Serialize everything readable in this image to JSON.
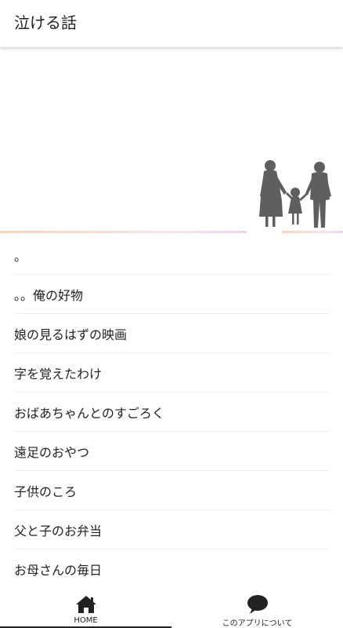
{
  "app_bar": {
    "title": "泣ける話"
  },
  "banner": {
    "icon": "family-silhouette-icon"
  },
  "stories": [
    {
      "title": "。"
    },
    {
      "title": "。。俺の好物"
    },
    {
      "title": "娘の見るはずの映画"
    },
    {
      "title": "字を覚えたわけ"
    },
    {
      "title": "おばあちゃんとのすごろく"
    },
    {
      "title": "遠足のおやつ"
    },
    {
      "title": "子供のころ"
    },
    {
      "title": "父と子のお弁当"
    },
    {
      "title": "お母さんの毎日"
    }
  ],
  "bottom_nav": {
    "items": [
      {
        "label": "HOME",
        "icon": "home-icon",
        "active": true
      },
      {
        "label": "このアプリについて",
        "icon": "speech-bubble-icon",
        "active": false
      }
    ]
  },
  "colors": {
    "accent": "#222222",
    "silhouette": "#5f5f5f",
    "divider": "#eeeeee"
  }
}
